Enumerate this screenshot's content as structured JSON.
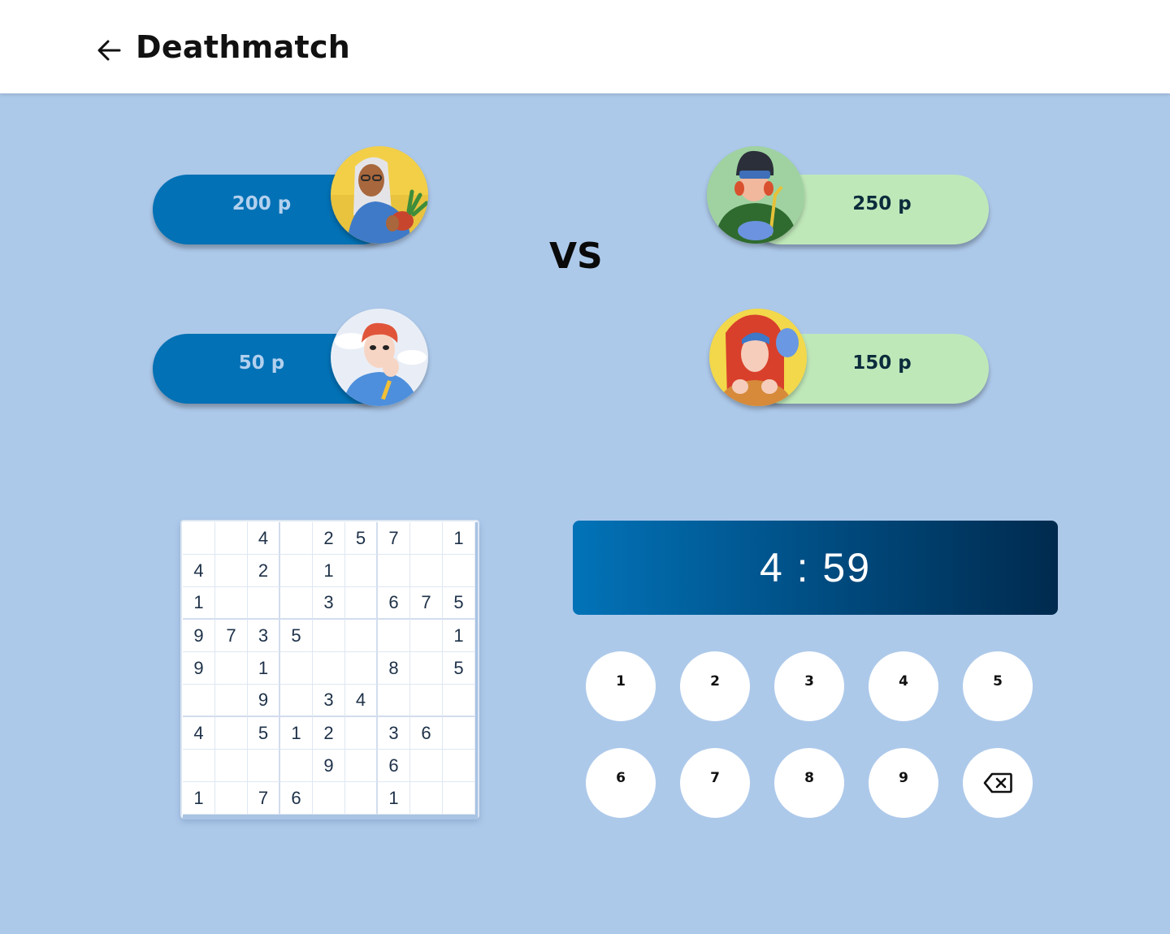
{
  "header": {
    "title": "Deathmatch"
  },
  "vs_label": "VS",
  "players": {
    "left_top": {
      "score": "200 p"
    },
    "left_bottom": {
      "score": "50 p"
    },
    "right_top": {
      "score": "250 p"
    },
    "right_bottom": {
      "score": "150 p"
    }
  },
  "timer": {
    "value": "4 : 59"
  },
  "keypad": {
    "keys": [
      "1",
      "2",
      "3",
      "4",
      "5",
      "6",
      "7",
      "8",
      "9"
    ],
    "delete_icon": "backspace-icon"
  },
  "sudoku": {
    "rows": [
      [
        "",
        "",
        "4",
        "",
        "2",
        "5",
        "7",
        "",
        "1"
      ],
      [
        "4",
        "",
        "2",
        "",
        "1",
        "",
        "",
        "",
        ""
      ],
      [
        "1",
        "",
        "",
        "",
        "3",
        "",
        "6",
        "7",
        "5"
      ],
      [
        "9",
        "7",
        "3",
        "5",
        "",
        "",
        "",
        "",
        "1"
      ],
      [
        "9",
        "",
        "1",
        "",
        "",
        "",
        "8",
        "",
        "5"
      ],
      [
        "",
        "",
        "9",
        "",
        "3",
        "4",
        "",
        "",
        ""
      ],
      [
        "4",
        "",
        "5",
        "1",
        "2",
        "",
        "3",
        "6",
        ""
      ],
      [
        "",
        "",
        "",
        "",
        "9",
        "",
        "6",
        "",
        ""
      ],
      [
        "1",
        "",
        "7",
        "6",
        "",
        "",
        "1",
        "",
        ""
      ]
    ]
  },
  "colors": {
    "background": "#adc9ea",
    "team_blue": "#0271b5",
    "team_green": "#bfe8b9",
    "timer_start": "#0273b8",
    "timer_end": "#002a4e"
  }
}
